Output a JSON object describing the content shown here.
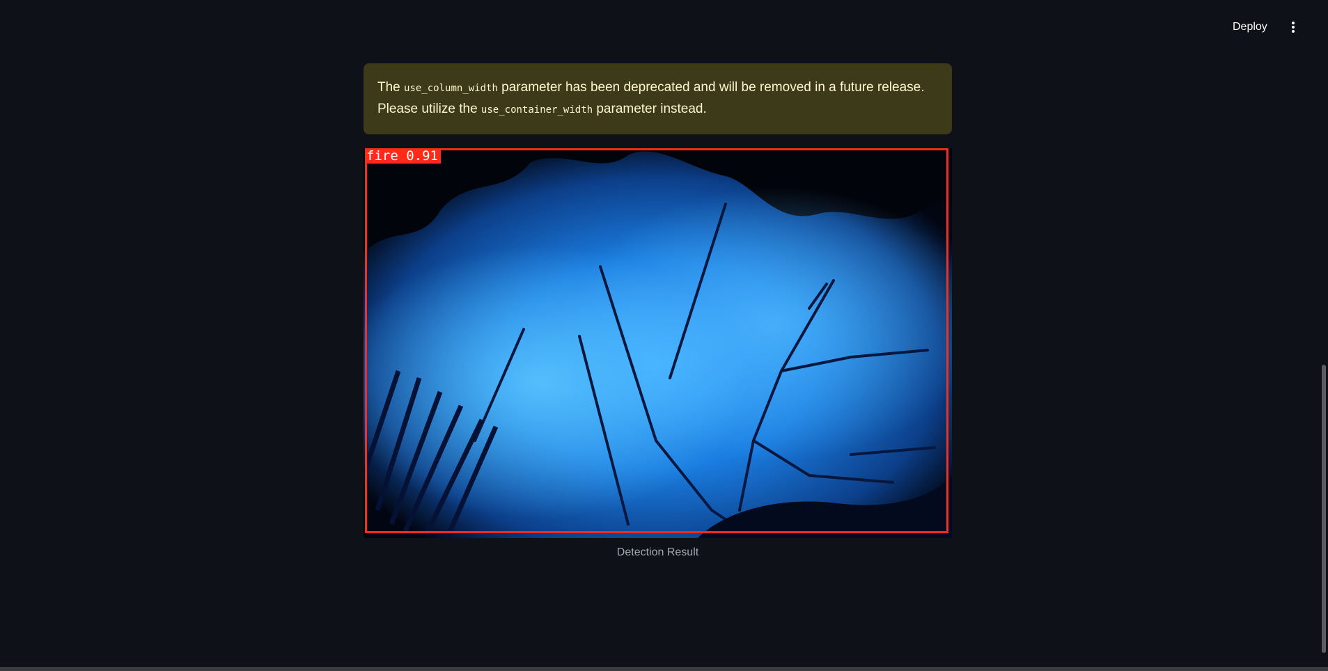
{
  "header": {
    "deploy_label": "Deploy",
    "menu_icon": "vertical-ellipsis-icon"
  },
  "warning": {
    "text_1": "The ",
    "code_1": "use_column_width",
    "text_2": " parameter has been deprecated and will be removed in a future release. Please utilize the ",
    "code_2": "use_container_width",
    "text_3": " parameter instead.",
    "background_color": "#3d3a19",
    "text_color": "#fdf6cf"
  },
  "detection": {
    "label": "fire 0.91",
    "box_color": "#ff2a1a"
  },
  "image": {
    "caption": "Detection Result"
  },
  "colors": {
    "background": "#0e1117",
    "accent": "#ff2a1a"
  }
}
